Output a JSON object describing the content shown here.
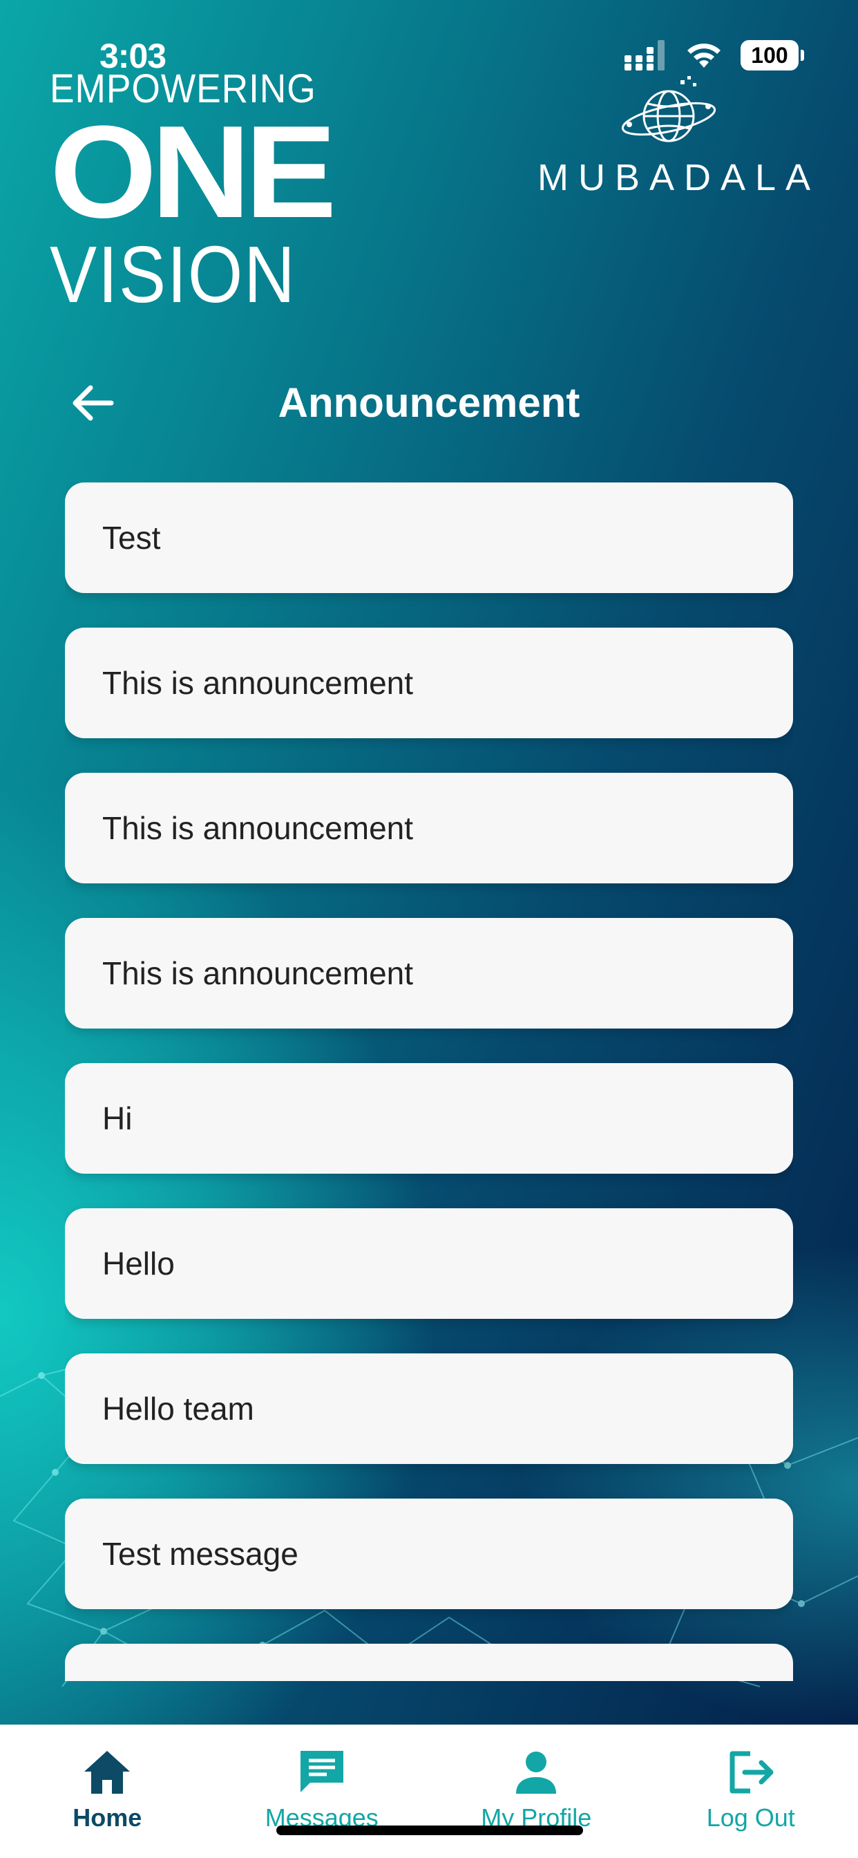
{
  "status_bar": {
    "time": "3:03",
    "battery": "100",
    "icons": [
      "signal-icon",
      "wifi-icon",
      "battery-icon"
    ]
  },
  "logos": {
    "left": {
      "line1": "EMPOWERING",
      "line2": "ONE",
      "line3": "VISION"
    },
    "right": {
      "text": "MUBADALA",
      "icon": "globe-icon"
    }
  },
  "header": {
    "title": "Announcement",
    "back_icon": "arrow-left-icon"
  },
  "announcements": [
    "Test",
    "This is announcement",
    "This is announcement",
    "This is announcement",
    "Hi",
    "Hello",
    "Hello team",
    "Test message",
    ""
  ],
  "tabbar": {
    "items": [
      {
        "label": "Home",
        "icon": "home-icon",
        "active": true
      },
      {
        "label": "Messages",
        "icon": "message-icon",
        "active": false
      },
      {
        "label": "My Profile",
        "icon": "profile-icon",
        "active": false
      },
      {
        "label": "Log Out",
        "icon": "logout-icon",
        "active": false
      }
    ]
  },
  "colors": {
    "accent": "#13a6a6",
    "home_active": "#0c4a66",
    "card_bg": "#f7f7f8",
    "gradient_dark": "#04204a",
    "gradient_teal": "#12c9c2"
  }
}
